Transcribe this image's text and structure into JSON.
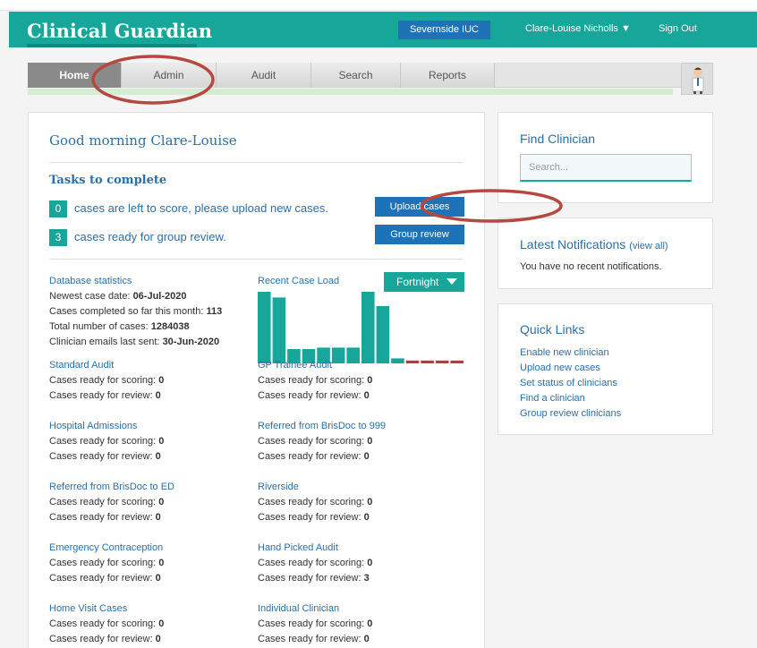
{
  "header": {
    "brand": "Clinical Guardian",
    "org": "Severnside IUC",
    "user": "Clare-Louise Nicholls ▼",
    "signout": "Sign Out",
    "bg_color": "#17a69a"
  },
  "nav": {
    "tabs": [
      "Home",
      "Admin",
      "Audit",
      "Search",
      "Reports"
    ],
    "active": "Home"
  },
  "main": {
    "greeting": "Good morning Clare-Louise",
    "tasks_title": "Tasks to complete",
    "task1_count": "0",
    "task1_text": "cases are left to score, please upload new cases.",
    "task1_button": "Upload cases",
    "task2_count": "3",
    "task2_text": "cases ready for group review.",
    "task2_button": "Group review",
    "db_stats": {
      "title": "Database statistics",
      "newest_label": "Newest case date: ",
      "newest_value": "06-Jul-2020",
      "completed_label": "Cases completed so far this month: ",
      "completed_value": "113",
      "total_label": "Total number of cases: ",
      "total_value": "1284038",
      "emails_label": "Clinician emails last sent: ",
      "emails_value": "30-Jun-2020"
    },
    "recent_case_load": "Recent Case Load",
    "period_button": "Fortnight",
    "audits": [
      {
        "title": "Standard Audit",
        "scoring": "0",
        "review": "0"
      },
      {
        "title": "GP Trainee Audit",
        "scoring": "0",
        "review": "0"
      },
      {
        "title": "Hospital Admissions",
        "scoring": "0",
        "review": "0"
      },
      {
        "title": "Referred from BrisDoc to 999",
        "scoring": "0",
        "review": "0"
      },
      {
        "title": "Referred from BrisDoc to ED",
        "scoring": "0",
        "review": "0"
      },
      {
        "title": "Riverside",
        "scoring": "0",
        "review": "0"
      },
      {
        "title": "Emergency Contraception",
        "scoring": "0",
        "review": "0"
      },
      {
        "title": "Hand Picked Audit",
        "scoring": "0",
        "review": "3"
      },
      {
        "title": "Home Visit Cases",
        "scoring": "0",
        "review": "0"
      },
      {
        "title": "Individual Clinician",
        "scoring": "0",
        "review": "0"
      }
    ],
    "scoring_label": "Cases ready for scoring: ",
    "review_label": "Cases ready for review: "
  },
  "sidebar": {
    "find_title": "Find Clinician",
    "search_placeholder": "Search...",
    "notif_title": "Latest Notifications",
    "view_all": "(view all)",
    "notif_empty": "You have no recent notifications.",
    "quick_title": "Quick Links",
    "quick_links": [
      "Enable new clinician",
      "Upload new cases",
      "Set status of clinicians",
      "Find a clinician",
      "Group review clinicians"
    ]
  },
  "chart_data": {
    "type": "bar",
    "values": [
      100,
      92,
      20,
      20,
      22,
      22,
      22,
      100,
      80,
      7,
      4,
      4,
      4,
      4
    ],
    "colors": [
      "#17a69a",
      "#17a69a",
      "#17a69a",
      "#17a69a",
      "#17a69a",
      "#17a69a",
      "#17a69a",
      "#17a69a",
      "#17a69a",
      "#17a69a",
      "#c0392b",
      "#c0392b",
      "#c0392b",
      "#c0392b"
    ],
    "ylim": [
      0,
      100
    ]
  }
}
